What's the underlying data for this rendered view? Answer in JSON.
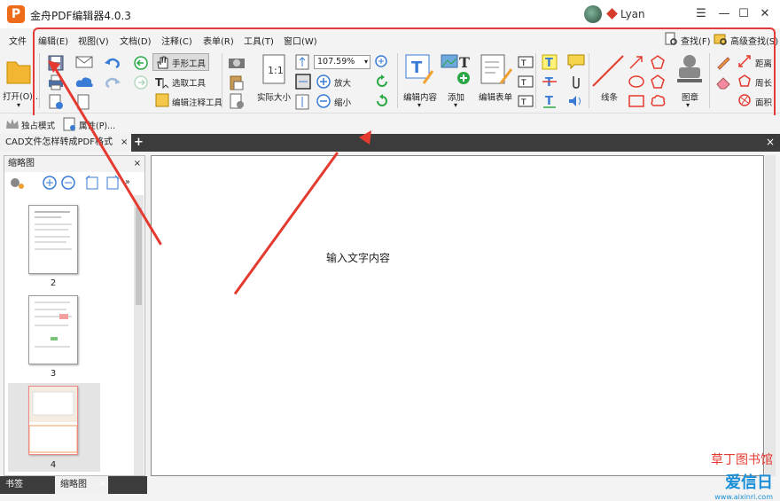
{
  "app": {
    "title": "金舟PDF编辑器4.0.3",
    "logo_letter": "P",
    "username": "Lyan"
  },
  "window_controls": {
    "menu": "☰",
    "minimize": "—",
    "maximize": "☐",
    "close": "✕"
  },
  "menu": [
    "文件",
    "编辑(E)",
    "视图(V)",
    "文档(D)",
    "注释(C)",
    "表单(R)",
    "工具(T)",
    "窗口(W)"
  ],
  "search": {
    "find": "查找(F)",
    "advanced_find": "高级查找(S)"
  },
  "toolbar": {
    "open": "打开(O)...",
    "hand_tool": "手形工具",
    "select_tool": "选取工具",
    "edit_annotation_tool": "编辑注释工具",
    "actual_size": "实际大小",
    "zoom_value": "107.59%",
    "zoom_in": "放大",
    "zoom_out": "缩小",
    "edit_content": "编辑内容",
    "add": "添加",
    "edit_form": "编辑表单",
    "line": "线条",
    "stamp": "图章",
    "distance": "距离",
    "perimeter": "周长",
    "area": "面积"
  },
  "subbar": {
    "exclusive_mode": "独占模式",
    "properties": "属性(P)..."
  },
  "document_tab": {
    "title": "CAD文件怎样转成PDF格式",
    "close": "×",
    "add": "+"
  },
  "thumbnail_panel": {
    "title": "缩略图",
    "close": "×",
    "pages": [
      "2",
      "3",
      "4"
    ]
  },
  "viewer": {
    "text_content": "输入文字内容"
  },
  "bottom_tabs": {
    "bookmarks": "书签",
    "thumbnails": "缩略图",
    "close": "×"
  },
  "watermark": {
    "line1": "草丁图书馆",
    "line2": "爱信日",
    "url": "www.aixinri.com"
  },
  "colors": {
    "accent": "#e03a3a",
    "brand": "#ee6b1a",
    "tab_dark": "#3c3c3c",
    "annotation_red": "#e53a2f"
  }
}
